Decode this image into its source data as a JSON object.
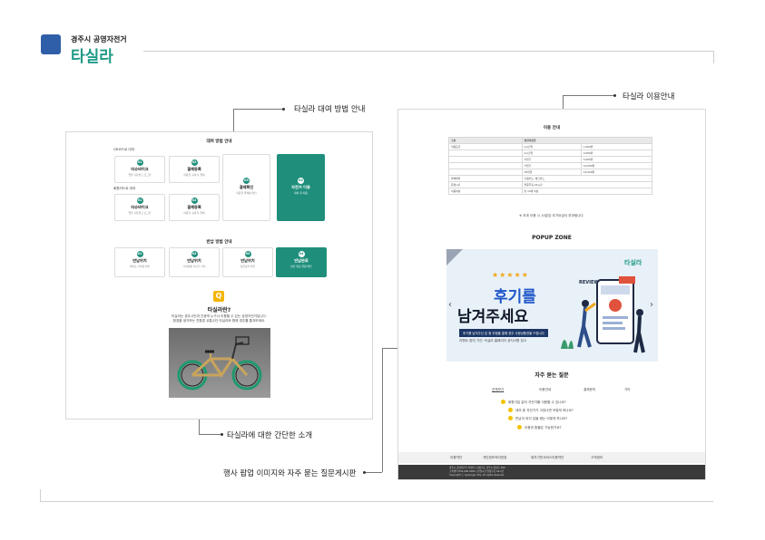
{
  "header": {
    "org": "경주시 공영자전거",
    "brand": "타실라"
  },
  "callouts": {
    "rental_method": "타실라 대여 방법 안내",
    "usage_guide": "타실라 이용안내",
    "intro": "타실라에 대한 간단한 소개",
    "popup_faq": "행사 팝업 이미지와 자주 묻는 질문게시판"
  },
  "left_panel": {
    "rental_title": "대여 방법 안내",
    "group1_label": "QR코드로 대여",
    "group2_label": "회원카드로 대여",
    "cards": [
      {
        "num": "01",
        "title": "타슈바이크",
        "desc": "앱을 다운받고 로그인"
      },
      {
        "num": "02",
        "title": "결제등록",
        "desc": "이용권 구매 후 결제"
      },
      {
        "num": "03",
        "title": "결제확인",
        "desc": "이용권 결제를 확인"
      },
      {
        "num": "04",
        "title": "자전거 이용",
        "desc": "대여 후 이용"
      },
      {
        "num": "01",
        "title": "타슈바이크",
        "desc": "앱을 다운받고 로그인"
      },
      {
        "num": "02",
        "title": "결제등록",
        "desc": "이용권 구매 후 결제"
      }
    ],
    "return_title": "반납 방법 안내",
    "return_cards": [
      {
        "num": "01",
        "title": "반납위치",
        "desc": "대여소 거치대 확인"
      },
      {
        "num": "02",
        "title": "반납위치",
        "desc": "거치대에 자전거 거치"
      },
      {
        "num": "03",
        "title": "반납위치",
        "desc": "잠금장치 확인"
      },
      {
        "num": "04",
        "title": "반납완료",
        "desc": "반납 완료 알림 확인"
      }
    ],
    "q_badge": "Q",
    "intro_title": "타실라란?",
    "intro_text1": "타실라는 경주시민과 관광객 누구나 이용할 수 있는 공영자전거입니다.",
    "intro_text2": "환경을 생각하는 친환경 교통수단 타실라와 함께 경주를 즐겨보세요."
  },
  "right_panel": {
    "usage_title": "이용 안내",
    "table_header": [
      "구분",
      "일반이용권"
    ],
    "table_rows": [
      [
        "이용요금",
        "1시간권",
        "1,000원"
      ],
      [
        "",
        "2시간권",
        "2,000원"
      ],
      [
        "",
        "1일권",
        "5,000원"
      ],
      [
        "",
        "7일권",
        "10,000원"
      ],
      [
        "",
        "30일권",
        "15,000원"
      ],
      [
        "결제방법",
        "신용카드, 체크카드",
        ""
      ],
      [
        "운영시간",
        "연중무휴 24시간",
        ""
      ],
      [
        "이용대상",
        "만 13세 이상",
        ""
      ]
    ],
    "table_note": "※ 초과 이용 시 10분당 추가요금이 부과됩니다.",
    "popup_zone": "POPUP ZONE",
    "popup_line1": "후기를",
    "popup_line2": "남겨주세요",
    "popup_stars": "★★★★★",
    "popup_badge": "후기를 남겨주신 분 중 추첨을 통해 경주 사랑상품권을 드립니다",
    "popup_sub": "이벤트 참여 기간: 타실라 홈페이지 공지사항 참고",
    "popup_brand": "타실라",
    "popup_review": "REVIEW",
    "faq_title": "자주 묻는 질문",
    "faq_tabs": [
      "전체보기",
      "이용안내",
      "결제문의",
      "기타"
    ],
    "faq_items": [
      "회원가입 없이 자전거를 이용할 수 있나요?",
      "대여 중 자전거가 고장나면 어떻게 하나요?",
      "반납이 되지 않을 때는 어떻게 하나요?",
      "이용권 환불은 가능한가요?"
    ],
    "footer_links": [
      "이용약관",
      "개인정보처리방침",
      "위치기반서비스이용약관",
      "고객센터"
    ],
    "footer_info": [
      "경주시 공영자전거 타실라 | 경상북도 경주시 양정로 260",
      "고객센터 054-000-0000 | 운영시간 연중무휴 24시간",
      "Copyright ⓒ Gyeongju City. All rights reserved."
    ]
  }
}
